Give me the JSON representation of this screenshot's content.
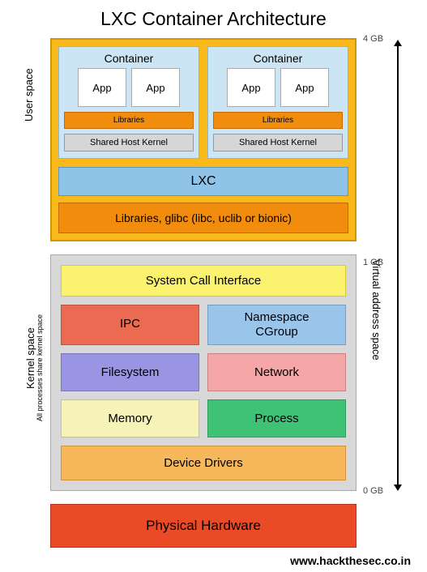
{
  "title": "LXC Container Architecture",
  "leftLabels": {
    "userSpace": "User space",
    "kernelSpace": "Kernel space",
    "kernelSub": "All processes share kernel space"
  },
  "rightLabel": "Virtual address space",
  "memMarkers": {
    "top": "4 GB",
    "mid": "1 GB",
    "bottom": "0 GB"
  },
  "userspace": {
    "containers": [
      {
        "title": "Container",
        "apps": [
          "App",
          "App"
        ],
        "libraries": "Libraries",
        "sharedKernel": "Shared Host Kernel"
      },
      {
        "title": "Container",
        "apps": [
          "App",
          "App"
        ],
        "libraries": "Libraries",
        "sharedKernel": "Shared Host Kernel"
      }
    ],
    "lxc": "LXC",
    "glibc": "Libraries, glibc (libc, uclib or bionic)"
  },
  "kernelspace": {
    "sci": "System Call Interface",
    "grid": {
      "ipc": "IPC",
      "namespace": "Namespace\nCGroup",
      "filesystem": "Filesystem",
      "network": "Network",
      "memory": "Memory",
      "process": "Process"
    },
    "deviceDrivers": "Device Drivers"
  },
  "hardware": "Physical Hardware",
  "footer": "www.hackthesec.co.in"
}
